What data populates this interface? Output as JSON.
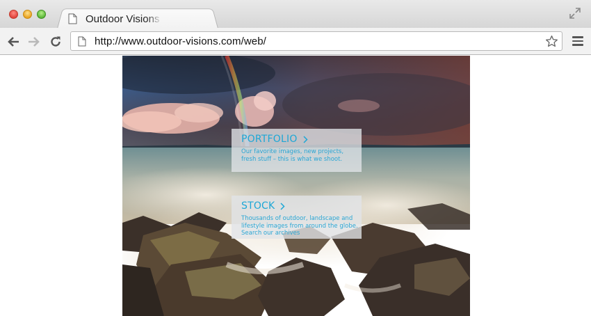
{
  "browser": {
    "tab_title": "Outdoor Visions",
    "url": "http://www.outdoor-visions.com/web/"
  },
  "page": {
    "portfolio": {
      "title": "PORTFOLIO",
      "text": "Our favorite images, new projects, fresh stuff – this is what we shoot."
    },
    "stock": {
      "title": "STOCK",
      "text": "Thousands of outdoor, landscape and lifestyle images from around the globe. Search our archives"
    }
  },
  "colors": {
    "accent": "#1da7d6"
  }
}
